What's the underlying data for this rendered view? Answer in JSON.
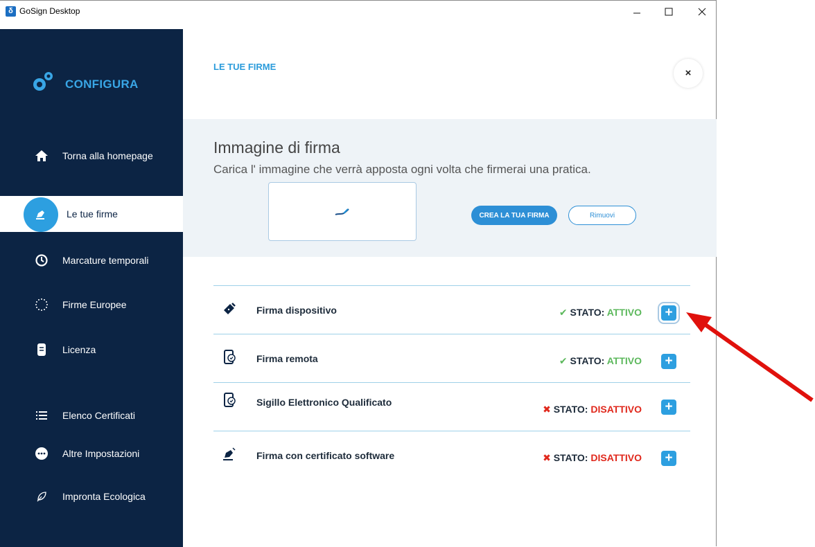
{
  "window": {
    "title": "GoSign Desktop",
    "icon_letter": "δ"
  },
  "window_controls": {
    "minimize": "—",
    "maximize": "☐",
    "close": "✕"
  },
  "sidebar": {
    "header": "CONFIGURA",
    "items": [
      {
        "label": "Torna alla homepage",
        "icon": "home-icon"
      },
      {
        "label": "Le tue firme",
        "icon": "pen-icon",
        "active": true
      },
      {
        "label": "Marcature temporali",
        "icon": "clock-icon"
      },
      {
        "label": "Firme Europee",
        "icon": "eu-stars-icon"
      },
      {
        "label": "Licenza",
        "icon": "license-icon"
      },
      {
        "label": "Elenco Certificati",
        "icon": "list-icon"
      },
      {
        "label": "Altre Impostazioni",
        "icon": "more-icon"
      },
      {
        "label": "Impronta Ecologica",
        "icon": "leaf-icon"
      }
    ]
  },
  "main": {
    "section_title": "LE TUE FIRME",
    "close_label": "×",
    "panel": {
      "title": "Immagine di firma",
      "subtitle": "Carica l' immagine che verrà apposta ogni volta che firmerai una pratica.",
      "create_button": "CREA LA TUA FIRMA",
      "remove_button": "Rimuovi"
    },
    "rows": [
      {
        "label": "Firma dispositivo",
        "status_prefix": "STATO:",
        "status_value": "ATTIVO",
        "active": true,
        "mark": "✔"
      },
      {
        "label": "Firma remota",
        "status_prefix": "STATO:",
        "status_value": "ATTIVO",
        "active": true,
        "mark": "✔"
      },
      {
        "label": "Sigillo Elettronico Qualificato",
        "status_prefix": "STATO:",
        "status_value": "DISATTIVO",
        "active": false,
        "mark": "✖"
      },
      {
        "label": "Firma con certificato software",
        "status_prefix": "STATO:",
        "status_value": "DISATTIVO",
        "active": false,
        "mark": "✖"
      }
    ],
    "plus_label": "+"
  },
  "colors": {
    "sidebar_bg": "#0c2444",
    "accent": "#2d9fe0",
    "active_status": "#5cb85c",
    "inactive_status": "#e0281c",
    "annotation_arrow": "#e0110c"
  }
}
